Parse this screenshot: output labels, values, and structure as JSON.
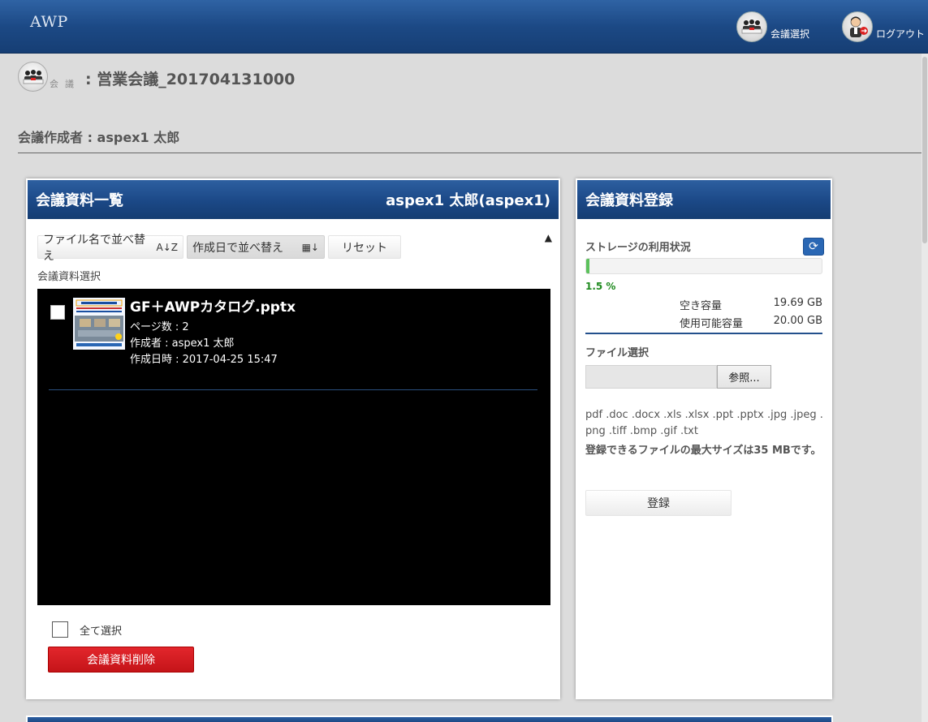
{
  "app": {
    "logo": "AWP",
    "nav": {
      "meeting_select": "会議選択",
      "logout": "ログアウト"
    }
  },
  "meeting": {
    "label": "会議",
    "title": ": 営業会議_201704131000",
    "creator": "会議作成者 : aspex1 太郎"
  },
  "list_panel": {
    "title": "会議資料一覧",
    "user": "aspex1 太郎(aspex1)",
    "sort_by_name": "ファイル名で並べ替え",
    "sort_by_name_glyph": "A↓Z",
    "sort_by_date": "作成日で並べ替え",
    "sort_by_date_glyph": "▦↓",
    "reset": "リセット",
    "collapse_glyph": "▲",
    "section_label": "会議資料選択",
    "files": [
      {
        "name": "GF＋AWPカタログ.pptx",
        "pages": "ページ数 : 2",
        "author": "作成者 : aspex1 太郎",
        "created": "作成日時 : 2017-04-25 15:47"
      }
    ],
    "select_all": "全て選択",
    "delete": "会議資料削除"
  },
  "register_panel": {
    "title": "会議資料登録",
    "storage_label": "ストレージの利用状況",
    "refresh_glyph": "⟳",
    "usage_percent": 1.5,
    "usage_text": "1.5 %",
    "free_label": "空き容量",
    "free_value": "19.69 GB",
    "available_label": "使用可能容量",
    "available_value": "20.00 GB",
    "file_select_label": "ファイル選択",
    "browse": "参照...",
    "extensions": "pdf .doc .docx .xls .xlsx .ppt .pptx .jpg .jpeg .png .tiff .bmp .gif .txt",
    "max_size": "登録できるファイルの最大サイズは35 MBです。",
    "register": "登録"
  },
  "icons": {
    "meeting": "meeting-people-icon",
    "logout": "user-logout-icon",
    "refresh": "refresh-icon"
  },
  "colors": {
    "header_blue": "#1c4985",
    "delete_red": "#d81e24",
    "progress_green": "#5cc15c",
    "percent_green": "#1e8a1e"
  }
}
